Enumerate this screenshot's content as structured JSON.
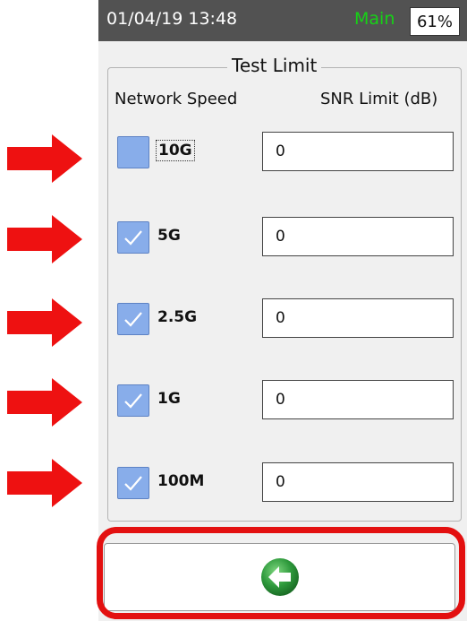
{
  "status_bar": {
    "datetime": "01/04/19 13:48",
    "mode": "Main",
    "battery": "61%"
  },
  "panel": {
    "title": "Test Limit",
    "col_speed": "Network Speed",
    "col_snr": "SNR Limit (dB)"
  },
  "rows": [
    {
      "speed": "10G",
      "checked": false,
      "snr": "0"
    },
    {
      "speed": "5G",
      "checked": true,
      "snr": "0"
    },
    {
      "speed": "2.5G",
      "checked": true,
      "snr": "0"
    },
    {
      "speed": "1G",
      "checked": true,
      "snr": "0"
    },
    {
      "speed": "100M",
      "checked": true,
      "snr": "0"
    }
  ],
  "colors": {
    "status_bg": "#525252",
    "mode_text": "#16d216",
    "checkbox": "#88adea",
    "highlight": "#e31010",
    "back_icon": "#2e9a3c"
  },
  "icons": {
    "back": "arrow-left-circle-icon",
    "annotation": "red-arrow-icon",
    "check": "checkmark-icon"
  }
}
